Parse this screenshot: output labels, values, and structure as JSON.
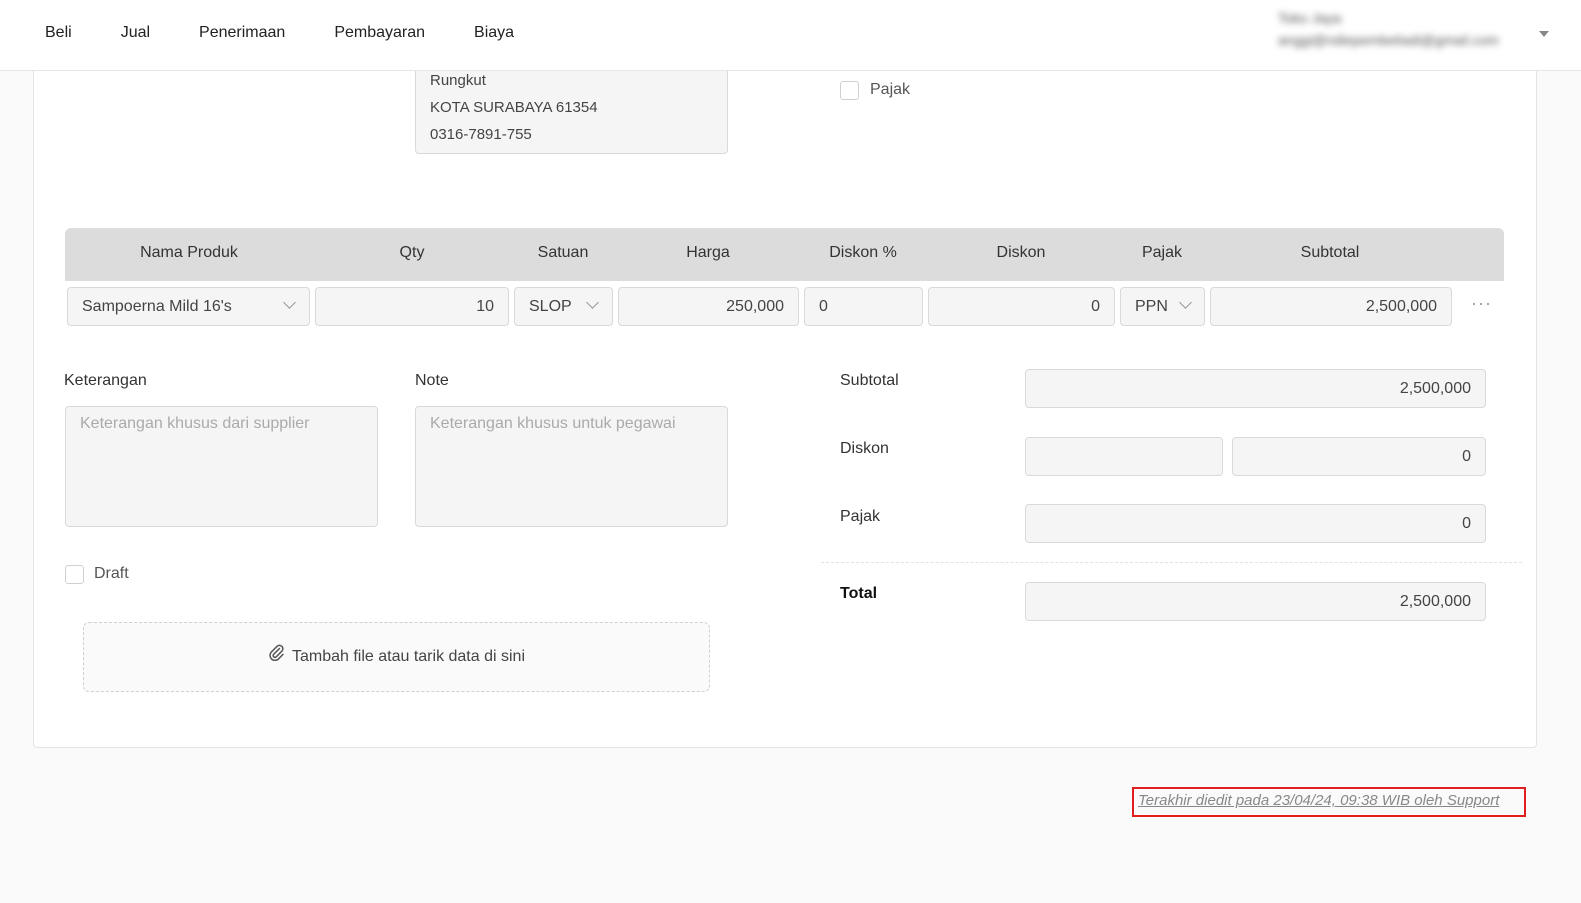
{
  "nav": {
    "items": [
      "Beli",
      "Jual",
      "Penerimaan",
      "Pembayaran",
      "Biaya"
    ],
    "user_name": "Toko Jaya",
    "user_email": "anggi@ndiepembeliadi@gmail.com"
  },
  "address": {
    "line1": "Rungkut",
    "line2": "KOTA SURABAYA 61354",
    "line3": "0316-7891-755"
  },
  "tax_checkbox_label": "Pajak",
  "table": {
    "headers": [
      "Nama Produk",
      "Qty",
      "Satuan",
      "Harga",
      "Diskon %",
      "Diskon",
      "Pajak",
      "Subtotal"
    ],
    "row": {
      "product": "Sampoerna Mild 16's",
      "qty": "10",
      "unit": "SLOP",
      "price": "250,000",
      "discount_pct": "0",
      "discount": "0",
      "tax": "PPN",
      "subtotal": "2,500,000"
    },
    "more_label": "···"
  },
  "notes": {
    "keterangan_label": "Keterangan",
    "keterangan_placeholder": "Keterangan khusus dari supplier",
    "note_label": "Note",
    "note_placeholder": "Keterangan khusus untuk pegawai"
  },
  "draft_label": "Draft",
  "upload_label": "Tambah file atau tarik data di sini",
  "summary": {
    "subtotal_label": "Subtotal",
    "subtotal_value": "2,500,000",
    "discount_label": "Diskon",
    "discount_value": "0",
    "tax_label": "Pajak",
    "tax_value": "0",
    "total_label": "Total",
    "total_value": "2,500,000"
  },
  "last_edited": "Terakhir diedit pada 23/04/24, 09:38 WIB oleh Support",
  "colors": {
    "highlight_border": "#e01e1e",
    "table_header_bg": "#dcdcdc"
  }
}
